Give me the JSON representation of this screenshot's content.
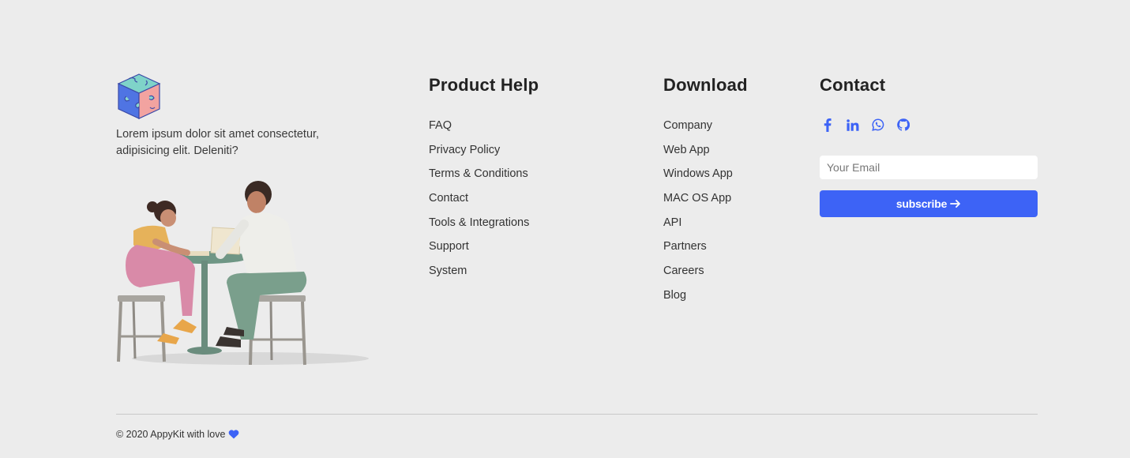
{
  "brand": {
    "logo_icon": "puzzle-cube-icon",
    "description": "Lorem ipsum dolor sit amet consectetur, adipisicing elit. Deleniti?",
    "illustration": "two-people-at-table-illustration"
  },
  "product_help": {
    "heading": "Product Help",
    "links": [
      "FAQ",
      "Privacy Policy",
      "Terms & Conditions",
      "Contact",
      "Tools & Integrations",
      "Support",
      "System"
    ]
  },
  "download": {
    "heading": "Download",
    "links": [
      "Company",
      "Web App",
      "Windows App",
      "MAC OS App",
      "API",
      "Partners",
      "Careers",
      "Blog"
    ]
  },
  "contact": {
    "heading": "Contact",
    "socials": [
      "facebook-icon",
      "linkedin-icon",
      "whatsapp-icon",
      "github-icon"
    ],
    "email_placeholder": "Your Email",
    "email_value": "",
    "subscribe_label": "subscribe",
    "subscribe_icon": "arrow-right-icon"
  },
  "footer": {
    "copyright": "© 2020 AppyKit with love",
    "heart_icon": "heart-icon"
  },
  "colors": {
    "accent": "#3d63f6",
    "background": "#ececec",
    "heading": "#222222"
  }
}
